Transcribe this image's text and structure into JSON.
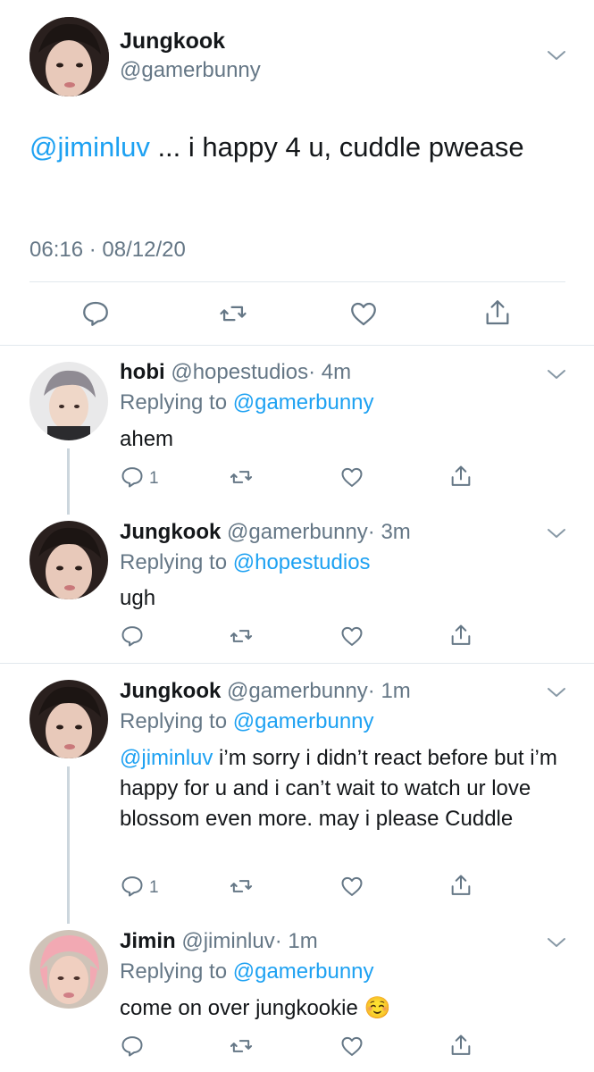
{
  "main_tweet": {
    "name": "Jungkook",
    "handle": "@gamerbunny",
    "mention": "@jiminluv",
    "text": " ... i happy 4 u, cuddle pwease",
    "timestamp": "06:16 · 08/12/20"
  },
  "replies": [
    {
      "name": "hobi",
      "handle": "@hopestudios",
      "time": "· 4m",
      "replying_prefix": "Replying to ",
      "replying_to": "@gamerbunny",
      "mention": "",
      "text": "ahem",
      "reply_count": "1"
    },
    {
      "name": "Jungkook",
      "handle": "@gamerbunny",
      "time": "· 3m",
      "replying_prefix": "Replying to ",
      "replying_to": "@hopestudios",
      "mention": "",
      "text": "ugh",
      "reply_count": ""
    },
    {
      "name": "Jungkook",
      "handle": "@gamerbunny",
      "time": "· 1m",
      "replying_prefix": "Replying to ",
      "replying_to": "@gamerbunny",
      "mention": "@jiminluv",
      "text": " i’m sorry i didn’t react before but i’m happy for u and i can’t wait to watch ur love blossom even more. may i please Cuddle",
      "reply_count": "1"
    },
    {
      "name": "Jimin",
      "handle": "@jiminluv",
      "time": "· 1m",
      "replying_prefix": "Replying to ",
      "replying_to": "@gamerbunny",
      "mention": "",
      "text": "come on over jungkookie ☺️",
      "reply_count": ""
    }
  ],
  "icons": {
    "reply": "reply-icon",
    "retweet": "retweet-icon",
    "like": "like-icon",
    "share": "share-icon",
    "more": "chevron-down-icon"
  },
  "colors": {
    "accent": "#1da1f2",
    "secondary_text": "#657786",
    "icon": "#657786",
    "divider": "#e1e8ed",
    "thread_line": "#ccd6dd"
  }
}
